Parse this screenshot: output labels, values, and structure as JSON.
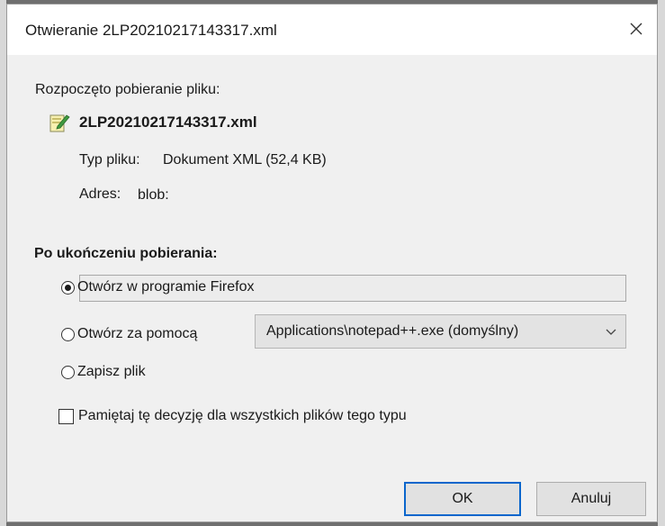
{
  "window": {
    "title": "Otwieranie 2LP20210217143317.xml",
    "close_icon": "close-icon"
  },
  "download": {
    "started_label": "Rozpoczęto pobieranie pliku:",
    "file_icon": "xml-file-icon",
    "file_name": "2LP20210217143317.xml",
    "type_label": "Typ pliku:",
    "type_value": "Dokument XML (52,4 KB)",
    "address_label": "Adres:",
    "address_value": "blob:"
  },
  "after_download": {
    "heading": "Po ukończeniu pobierania:",
    "options": [
      {
        "label": "Otwórz w programie Firefox",
        "checked": true
      },
      {
        "label": "Otwórz za pomocą",
        "checked": false
      },
      {
        "label": "Zapisz plik",
        "checked": false
      }
    ],
    "open_with_selected": "Applications\\notepad++.exe (domyślny)",
    "remember_label": "Pamiętaj tę decyzję dla wszystkich plików tego typu",
    "remember_checked": false
  },
  "buttons": {
    "ok": "OK",
    "cancel": "Anuluj"
  },
  "colors": {
    "accent_focus": "#0a66cc",
    "dialog_bg": "#f0f0f0",
    "titlebar_bg": "#ffffff"
  }
}
